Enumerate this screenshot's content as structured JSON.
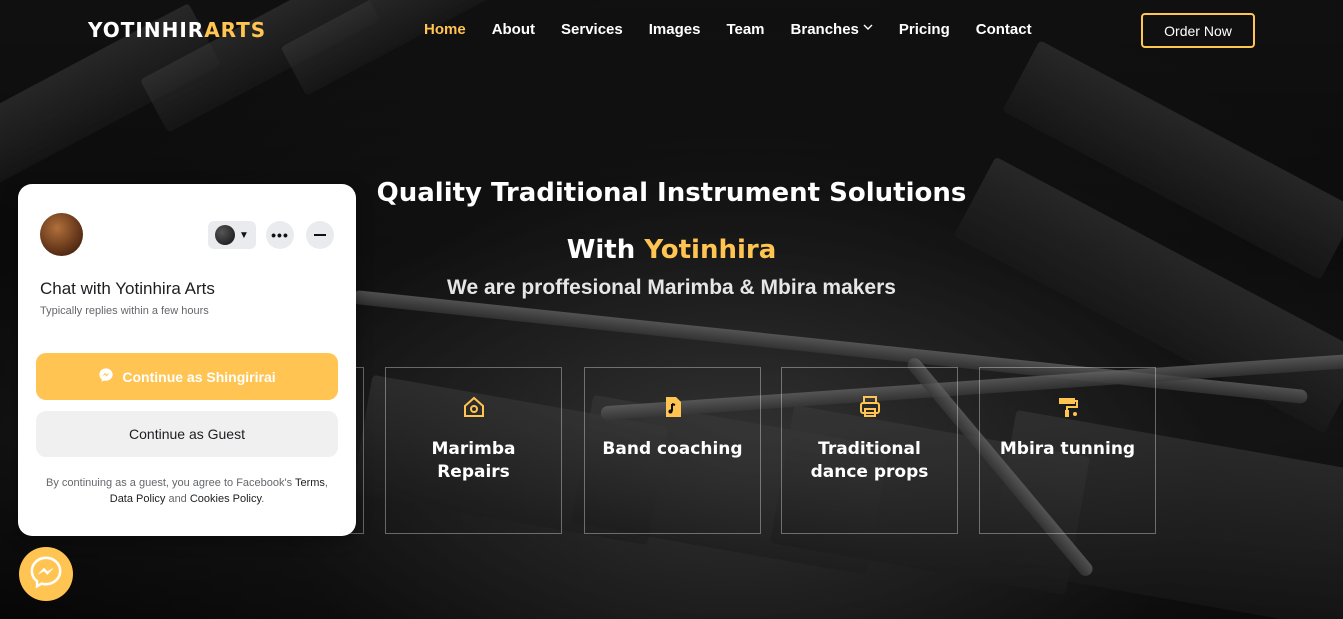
{
  "header": {
    "logo_main": "YOTINHIR",
    "logo_accent": "ARTS",
    "nav": [
      {
        "label": "Home",
        "active": true
      },
      {
        "label": "About",
        "active": false
      },
      {
        "label": "Services",
        "active": false
      },
      {
        "label": "Images",
        "active": false
      },
      {
        "label": "Team",
        "active": false
      },
      {
        "label": "Branches",
        "active": false,
        "dropdown": true
      },
      {
        "label": "Pricing",
        "active": false
      },
      {
        "label": "Contact",
        "active": false
      }
    ],
    "order_button": "Order Now"
  },
  "hero": {
    "title_line1": "Quality Traditional Instrument Solutions",
    "title_line2_prefix": "With ",
    "title_line2_accent": "Yotinhira",
    "subtitle": "We are proffesional Marimba & Mbira makers"
  },
  "services": [
    {
      "label_l1": "Marimba",
      "label_l2": "Repairs",
      "icon": "home-gear-icon"
    },
    {
      "label_l1": "Band coaching",
      "label_l2": "",
      "icon": "music-file-icon"
    },
    {
      "label_l1": "Traditional",
      "label_l2": "dance props",
      "icon": "printer-icon"
    },
    {
      "label_l1": "Mbira tunning",
      "label_l2": "",
      "icon": "paint-roller-icon"
    }
  ],
  "chat": {
    "title": "Chat with Yotinhira Arts",
    "subtitle": "Typically replies within a few hours",
    "primary_button": "Continue as Shingirirai",
    "secondary_button": "Continue as Guest",
    "legal_prefix": "By continuing as a guest, you agree to Facebook's ",
    "legal_terms": "Terms",
    "legal_sep": ",",
    "legal_data": "Data Policy",
    "legal_and": " and ",
    "legal_cookies": "Cookies Policy",
    "legal_end": "."
  },
  "colors": {
    "accent": "#ffc451",
    "background": "#0d0d0d"
  }
}
